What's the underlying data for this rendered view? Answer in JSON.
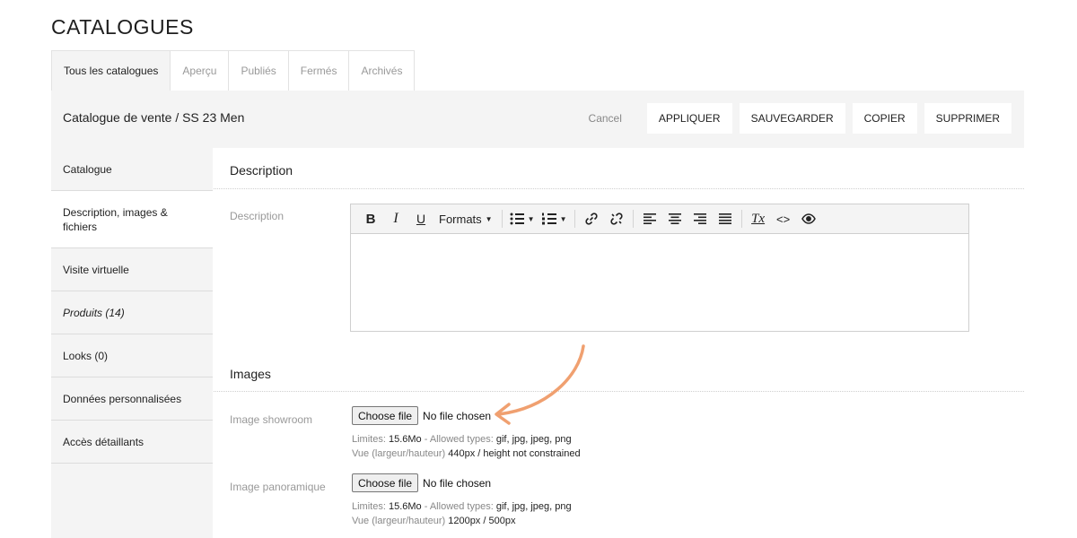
{
  "page": {
    "title": "CATALOGUES"
  },
  "tabs": [
    {
      "label": "Tous les catalogues",
      "active": true
    },
    {
      "label": "Aperçu"
    },
    {
      "label": "Publiés"
    },
    {
      "label": "Fermés"
    },
    {
      "label": "Archivés"
    }
  ],
  "header": {
    "breadcrumb": "Catalogue de vente / SS 23 Men",
    "cancel": "Cancel",
    "buttons": {
      "apply": "APPLIQUER",
      "save": "SAUVEGARDER",
      "copy": "COPIER",
      "delete": "SUPPRIMER"
    }
  },
  "sidebar": {
    "items": [
      {
        "label": "Catalogue"
      },
      {
        "label": "Description, images & fichiers",
        "active": true
      },
      {
        "label": "Visite virtuelle"
      },
      {
        "label": "Produits (14)"
      },
      {
        "label": "Looks (0)"
      },
      {
        "label": "Données personnalisées"
      },
      {
        "label": "Accès détaillants"
      }
    ]
  },
  "description": {
    "section_title": "Description",
    "field_label": "Description",
    "toolbar": {
      "bold": "B",
      "italic": "I",
      "underline": "U",
      "formats": "Formats",
      "clear_format": "Tx",
      "source": "<>"
    }
  },
  "images": {
    "section_title": "Images",
    "fields": [
      {
        "label": "Image showroom",
        "button": "Choose file",
        "status": "No file chosen",
        "limits_label": "Limites:",
        "limits_value": "15.6Mo",
        "types_label": "- Allowed types:",
        "types_value": "gif, jpg, jpeg, png",
        "view_label": "Vue (largeur/hauteur)",
        "view_value": "440px / height not constrained"
      },
      {
        "label": "Image panoramique",
        "button": "Choose file",
        "status": "No file chosen",
        "limits_label": "Limites:",
        "limits_value": "15.6Mo",
        "types_label": "- Allowed types:",
        "types_value": "gif, jpg, jpeg, png",
        "view_label": "Vue (largeur/hauteur)",
        "view_value": "1200px / 500px"
      }
    ]
  },
  "colors": {
    "accent_arrow": "#f0a070",
    "panel_bg": "#f4f4f4"
  }
}
